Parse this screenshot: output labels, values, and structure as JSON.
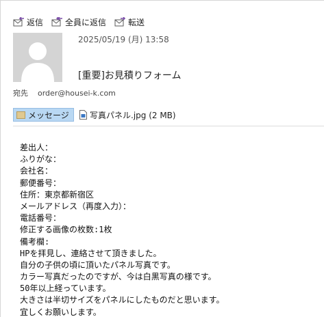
{
  "toolbar": {
    "reply_label": "返信",
    "reply_all_label": "全員に返信",
    "forward_label": "転送"
  },
  "message": {
    "timestamp": "2025/05/19 (月) 13:58",
    "subject": "[重要]お見積りフォーム",
    "to_label": "宛先",
    "to_address": "order@housei-k.com"
  },
  "attachments": {
    "message_tab": "メッセージ",
    "file_name": "写真パネル.jpg (2 MB)"
  },
  "body_lines": [
    "差出人：",
    "ふりがな：",
    "会社名：",
    "郵便番号：",
    "住所：東京都新宿区",
    "メールアドレス（再度入力）：",
    "電話番号：",
    "修正する画像の枚数:1枚",
    "備考欄:",
    "HPを拝見し、連絡させて頂きました。",
    "自分の子供の頃に頂いたパネル写真です。",
    "カラー写真だったのですが、今は白黒写真の様です。",
    "50年以上経っています。",
    "大きさは半切サイズをパネルにしたものだと思います。",
    "宜しくお願いします。"
  ],
  "colors": {
    "icon_purple": "#7b4fa8",
    "message_tab_bg": "#b9d8f3",
    "avatar_bg": "#d4d4d4"
  }
}
